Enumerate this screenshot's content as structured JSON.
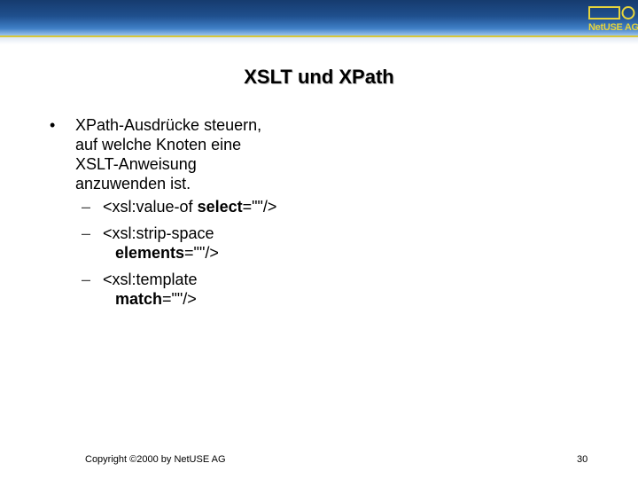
{
  "header": {
    "logo_text": "NetUSE AG",
    "line_color": "#d7c73a",
    "logo_color": "#e6d43c"
  },
  "title": "XSLT und XPath",
  "bullet": {
    "mark": "•",
    "lines": [
      "XPath-Ausdrücke steuern,",
      "auf welche Knoten eine",
      "XSLT-Anweisung",
      "anzuwenden ist."
    ]
  },
  "sub_items": [
    {
      "dash": "–",
      "pre": "<xsl:value-of ",
      "attr": "select",
      "post": "=\"\"/>"
    },
    {
      "dash": "–",
      "line1": "<xsl:strip-space",
      "attr": "elements",
      "post": "=\"\"/>"
    },
    {
      "dash": "–",
      "line1": "<xsl:template",
      "attr": "match",
      "post": "=\"\"/>"
    }
  ],
  "footer": {
    "copyright": "Copyright ©2000 by NetUSE AG",
    "page_number": "30"
  }
}
